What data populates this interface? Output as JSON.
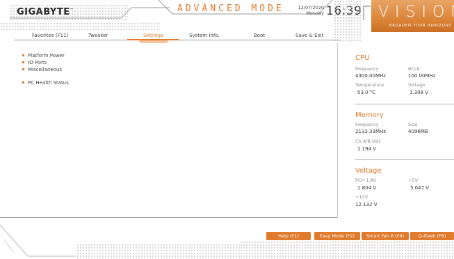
{
  "header": {
    "brand": "GIGABYTE",
    "brand_tm": "™",
    "mode_title": "ADVANCED MODE",
    "date": "12/07/2020",
    "weekday": "Monday",
    "time": "16:39",
    "vision_word": "VISION",
    "vision_tagline": "BROADEN YOUR HORIZONS"
  },
  "tabs": [
    {
      "label": "Favorites (F11)",
      "active": false
    },
    {
      "label": "Tweaker",
      "active": false
    },
    {
      "label": "Settings",
      "active": true
    },
    {
      "label": "System Info.",
      "active": false
    },
    {
      "label": "Boot",
      "active": false
    },
    {
      "label": "Save & Exit",
      "active": false
    }
  ],
  "menu": {
    "items": [
      {
        "label": "Platform Power"
      },
      {
        "label": "IO Ports"
      },
      {
        "label": "Miscellaneous"
      },
      {
        "label": "PC Health Status"
      }
    ]
  },
  "cpu": {
    "title": "CPU",
    "frequency_label": "Frequency",
    "frequency_value": "4300.00MHz",
    "bclk_label": "BCLK",
    "bclk_value": "100.00MHz",
    "temperature_label": "Temperature",
    "temperature_value": "53.0 °C",
    "voltage_label": "Voltage",
    "voltage_value": "1.308 V"
  },
  "memory": {
    "title": "Memory",
    "frequency_label": "Frequency",
    "frequency_value": "2133.33MHz",
    "size_label": "Size",
    "size_value": "4096MB",
    "ch_volt_label": "Ch A/B Volt",
    "ch_volt_value": "1.194 V"
  },
  "voltage": {
    "title": "Voltage",
    "pch_label": "PCH 1.8V",
    "pch_value": "1.804 V",
    "p5v_label": "+5V",
    "p5v_value": "5.047 V",
    "p12v_label": "+12V",
    "p12v_value": "12.132 V"
  },
  "footer": {
    "help": "Help (F1)",
    "easy_mode": "Easy Mode (F2)",
    "smart_fan": "Smart Fan 6 (F6)",
    "qflash": "Q-Flash (F8)"
  },
  "colors": {
    "accent": "#e07a2d",
    "text": "#444444",
    "muted_label": "#8a8a8a"
  }
}
